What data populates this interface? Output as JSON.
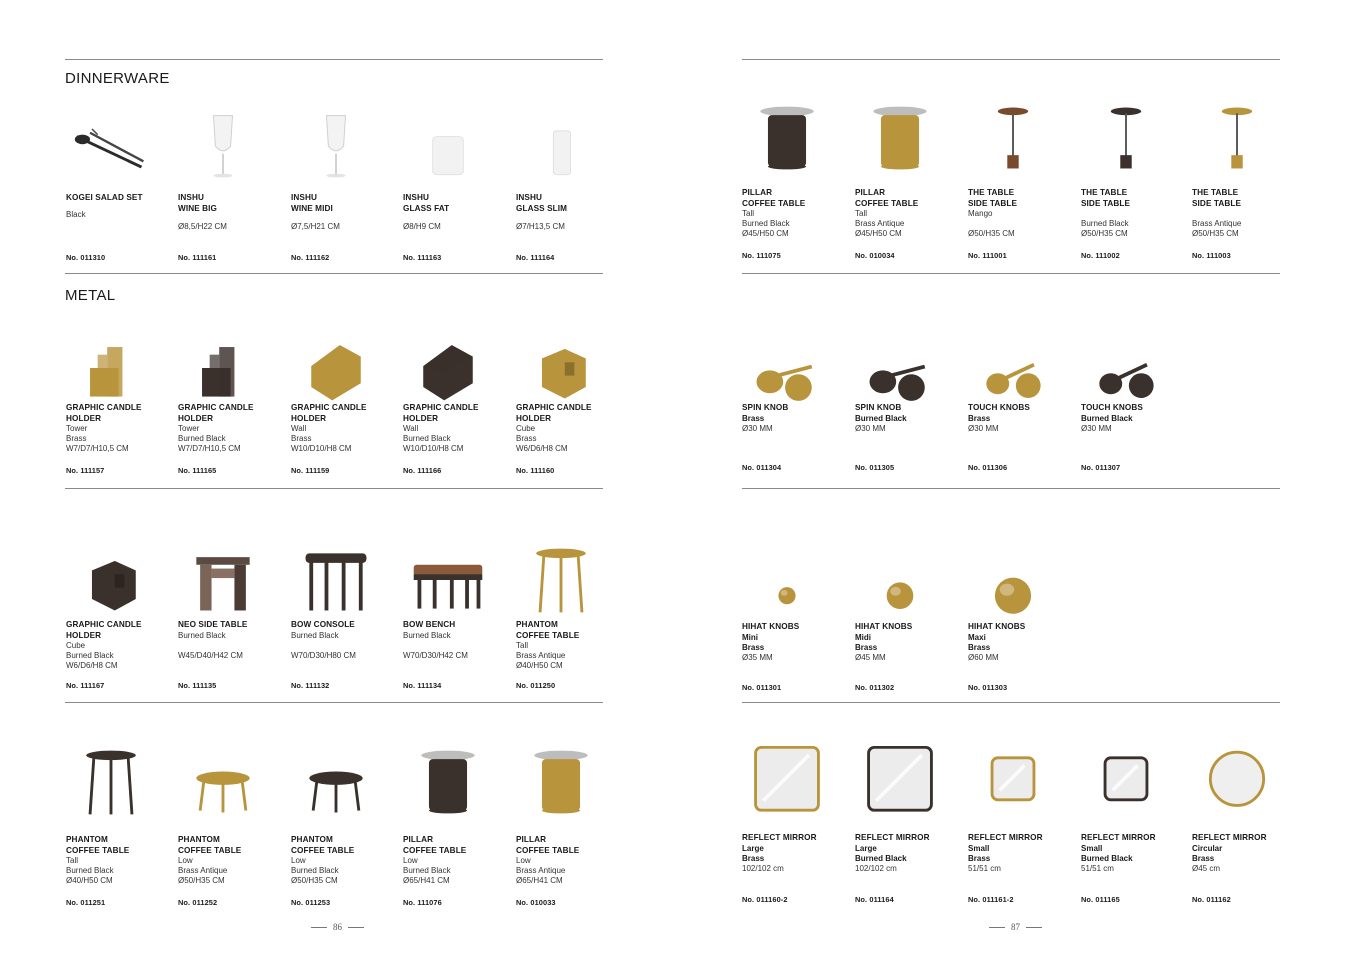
{
  "colors": {
    "brass": "#b8943c",
    "burned_black": "#3a302c",
    "mango": "#7a4a2e",
    "rule": "#8a8a8a"
  },
  "left": {
    "page_number": "86",
    "sections": {
      "dinnerware": "DINNERWARE",
      "metal": "METAL"
    },
    "rows": [
      [
        {
          "icon": "salad-set-icon",
          "name": "KOGEI SALAD SET",
          "meta": "Black",
          "sku": "No. 011310"
        },
        {
          "icon": "wine-glass-icon",
          "name": "INSHU\nWINE BIG",
          "meta": "Ø8,5/H22 CM",
          "sku": "No. 111161"
        },
        {
          "icon": "wine-glass-icon",
          "name": "INSHU\nWINE MIDI",
          "meta": "Ø7,5/H21 CM",
          "sku": "No. 111162"
        },
        {
          "icon": "tumbler-icon",
          "name": "INSHU\nGLASS FAT",
          "meta": "Ø8/H9 CM",
          "sku": "No. 111163"
        },
        {
          "icon": "tall-glass-icon",
          "name": "INSHU\nGLASS SLIM",
          "meta": "Ø7/H13,5 CM",
          "sku": "No. 111164"
        }
      ],
      [
        {
          "icon": "candle-holder-tower-icon",
          "name": "GRAPHIC CANDLE\nHOLDER",
          "meta": "Tower\nBrass\nW7/D7/H10,5 CM",
          "sku": "No. 111157"
        },
        {
          "icon": "candle-holder-tower-icon",
          "name": "GRAPHIC CANDLE\nHOLDER",
          "meta": "Tower\nBurned Black\nW7/D7/H10,5 CM",
          "sku": "No. 111165"
        },
        {
          "icon": "candle-holder-wall-icon",
          "name": "GRAPHIC CANDLE\nHOLDER",
          "meta": "Wall\nBrass\nW10/D10/H8 CM",
          "sku": "No. 111159"
        },
        {
          "icon": "candle-holder-wall-icon",
          "name": "GRAPHIC CANDLE\nHOLDER",
          "meta": "Wall\nBurned Black\nW10/D10/H8 CM",
          "sku": "No. 111166"
        },
        {
          "icon": "candle-holder-cube-icon",
          "name": "GRAPHIC CANDLE\nHOLDER",
          "meta": "Cube\nBrass\nW6/D6/H8 CM",
          "sku": "No. 111160"
        }
      ],
      [
        {
          "icon": "candle-holder-cube-icon",
          "name": "GRAPHIC CANDLE\nHOLDER",
          "meta": "Cube\nBurned Black\nW6/D6/H8 CM",
          "sku": "No. 111167"
        },
        {
          "icon": "side-table-icon",
          "name": "NEO SIDE TABLE",
          "meta": "Burned Black\n\nW45/D40/H42 CM",
          "sku": "No. 111135"
        },
        {
          "icon": "console-icon",
          "name": "BOW CONSOLE",
          "meta": "Burned Black\n\nW70/D30/H80 CM",
          "sku": "No. 111132"
        },
        {
          "icon": "bench-icon",
          "name": "BOW BENCH",
          "meta": "Burned Black\n\nW70/D30/H42 CM",
          "sku": "No. 111134"
        },
        {
          "icon": "tall-table-icon",
          "name": "PHANTOM\nCOFFEE TABLE",
          "meta": "Tall\nBrass Antique\nØ40/H50 CM",
          "sku": "No. 011250"
        }
      ],
      [
        {
          "icon": "tall-table-icon",
          "name": "PHANTOM\nCOFFEE TABLE",
          "meta": "Tall\nBurned Black\nØ40/H50 CM",
          "sku": "No. 011251"
        },
        {
          "icon": "low-table-icon",
          "name": "PHANTOM\nCOFFEE TABLE",
          "meta": "Low\nBrass Antique\nØ50/H35 CM",
          "sku": "No. 011252"
        },
        {
          "icon": "low-table-icon",
          "name": "PHANTOM\nCOFFEE TABLE",
          "meta": "Low\nBurned Black\nØ50/H35 CM",
          "sku": "No. 011253"
        },
        {
          "icon": "pillar-table-icon",
          "name": "PILLAR\nCOFFEE TABLE",
          "meta": "Low\nBurned Black\nØ65/H41 CM",
          "sku": "No. 111076"
        },
        {
          "icon": "pillar-table-icon",
          "name": "PILLAR\nCOFFEE TABLE",
          "meta": "Low\nBrass Antique\nØ65/H41 CM",
          "sku": "No. 010033"
        }
      ]
    ]
  },
  "right": {
    "page_number": "87",
    "rows": [
      [
        {
          "icon": "pillar-table-icon",
          "name": "PILLAR\nCOFFEE TABLE",
          "meta": "Tall\nBurned Black\nØ45/H50 CM",
          "sku": "No. 111075"
        },
        {
          "icon": "pillar-table-icon",
          "name": "PILLAR\nCOFFEE TABLE",
          "meta": "Tall\nBrass Antique\nØ45/H50 CM",
          "sku": "No. 010034"
        },
        {
          "icon": "lamp-table-icon",
          "name": "THE TABLE\nSIDE TABLE",
          "meta": "Mango\n\nØ50/H35 CM",
          "sku": "No. 111001"
        },
        {
          "icon": "lamp-table-icon",
          "name": "THE TABLE\nSIDE TABLE",
          "meta": "\nBurned Black\nØ50/H35 CM",
          "sku": "No. 111002"
        },
        {
          "icon": "lamp-table-icon",
          "name": "THE TABLE\nSIDE TABLE",
          "meta": "\nBrass Antique\nØ50/H35 CM",
          "sku": "No. 111003"
        }
      ],
      [
        {
          "icon": "spin-knob-icon",
          "name": "SPIN KNOB",
          "bold": "Brass",
          "meta": "Ø30 MM",
          "sku": "No. 011304"
        },
        {
          "icon": "spin-knob-icon",
          "name": "SPIN KNOB",
          "bold": "Burned Black",
          "meta": "Ø30 MM",
          "sku": "No. 011305"
        },
        {
          "icon": "touch-knob-icon",
          "name": "TOUCH KNOBS",
          "bold": "Brass",
          "meta": "Ø30 MM",
          "sku": "No. 011306"
        },
        {
          "icon": "touch-knob-icon",
          "name": "TOUCH KNOBS",
          "bold": "Burned Black",
          "meta": "Ø30 MM",
          "sku": "No. 011307"
        }
      ],
      [
        {
          "icon": "hihat-knob-icon",
          "name": "HIHAT KNOBS",
          "bold": "Mini\nBrass",
          "meta": "Ø35 MM",
          "sku": "No. 011301"
        },
        {
          "icon": "hihat-knob-icon",
          "name": "HIHAT KNOBS",
          "bold": "Midi\nBrass",
          "meta": "Ø45 MM",
          "sku": "No. 011302"
        },
        {
          "icon": "hihat-knob-icon",
          "name": "HIHAT KNOBS",
          "bold": "Maxi\nBrass",
          "meta": "Ø60 MM",
          "sku": "No. 011303"
        }
      ],
      [
        {
          "icon": "square-mirror-icon",
          "name": "REFLECT MIRROR",
          "bold": "Large\nBrass",
          "meta": "102/102 cm",
          "sku": "No. 011160-2"
        },
        {
          "icon": "square-mirror-icon",
          "name": "REFLECT MIRROR",
          "bold": "Large\nBurned Black",
          "meta": "102/102 cm",
          "sku": "No. 011164"
        },
        {
          "icon": "square-mirror-icon",
          "name": "REFLECT MIRROR",
          "bold": "Small\nBrass",
          "meta": "51/51 cm",
          "sku": "No. 011161-2"
        },
        {
          "icon": "square-mirror-icon",
          "name": "REFLECT MIRROR",
          "bold": "Small\nBurned Black",
          "meta": "51/51 cm",
          "sku": "No. 011165"
        },
        {
          "icon": "round-mirror-icon",
          "name": "REFLECT MIRROR",
          "bold": "Circular\nBrass",
          "meta": "Ø45 cm",
          "sku": "No. 011162"
        }
      ]
    ]
  }
}
